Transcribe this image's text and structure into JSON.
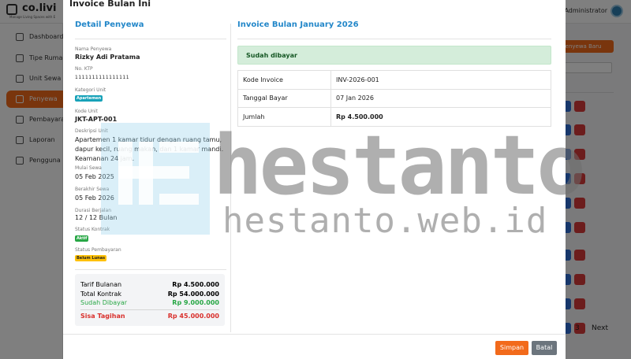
{
  "app": {
    "brand": "co.livi",
    "brand_sub": "Manage Living Spaces with E",
    "greeting": "Hi, Administrator",
    "sidebar": [
      {
        "label": "Dashboard"
      },
      {
        "label": "Tipe Rumah/"
      },
      {
        "label": "Unit Sewa"
      },
      {
        "label": "Penyewa",
        "active": true
      },
      {
        "label": "Pembayaran"
      },
      {
        "label": "Laporan"
      },
      {
        "label": "Pengguna"
      }
    ],
    "add_button": "h Penyewa Baru",
    "pagination": {
      "page": "3",
      "next": "Next"
    }
  },
  "modal": {
    "title": "Invoice Bulan Ini",
    "detail": {
      "section_title": "Detail Penyewa",
      "nama_label": "Nama Penyewa",
      "nama": "Rizky Adi Pratama",
      "ktp_label": "No. KTP",
      "ktp": "1111111111111111",
      "kategori_label": "Kategori Unit",
      "kategori": "Apartemen",
      "kode_label": "Kode Unit",
      "kode": "JKT-APT-001",
      "deskripsi_label": "Deskripsi Unit",
      "deskripsi": "Apartemen 1 kamar tidur dengan ruang tamu, dapur kecil, ruang makan, dan 1 kamar mandi. Keamanan 24 jam.",
      "mulai_label": "Mulai Sewa",
      "mulai": "05 Feb 2025",
      "berakhir_label": "Berakhir Sewa",
      "berakhir": "05 Feb 2026",
      "durasi_label": "Durasi Berjalan",
      "durasi": "12 / 12 Bulan",
      "status_kontrak_label": "Status Kontrak",
      "status_kontrak": "Aktif",
      "status_bayar_label": "Status Pembayaran",
      "status_bayar": "Belum Lunas"
    },
    "summary": {
      "tarif_label": "Tarif Bulanan",
      "tarif": "Rp 4.500.000",
      "total_label": "Total Kontrak",
      "total": "Rp 54.000.000",
      "dibayar_label": "Sudah Dibayar",
      "dibayar": "Rp 9.000.000",
      "sisa_label": "Sisa Tagihan",
      "sisa": "Rp 45.000.000"
    },
    "invoice": {
      "section_title": "Invoice Bulan January 2026",
      "alert": "Sudah dibayar",
      "rows": [
        {
          "key": "Kode Invoice",
          "value": "INV-2026-001"
        },
        {
          "key": "Tanggal Bayar",
          "value": "07 Jan 2026"
        },
        {
          "key": "Jumlah",
          "value": "Rp 4.500.000"
        }
      ]
    },
    "save": "Simpan",
    "cancel": "Batal"
  },
  "watermark": {
    "text": "hestanto",
    "url": "hestanto.web.id"
  },
  "colors": {
    "accent": "#f26a1b",
    "title_blue": "#2387c9",
    "success": "#28a745",
    "danger": "#d9302c"
  }
}
